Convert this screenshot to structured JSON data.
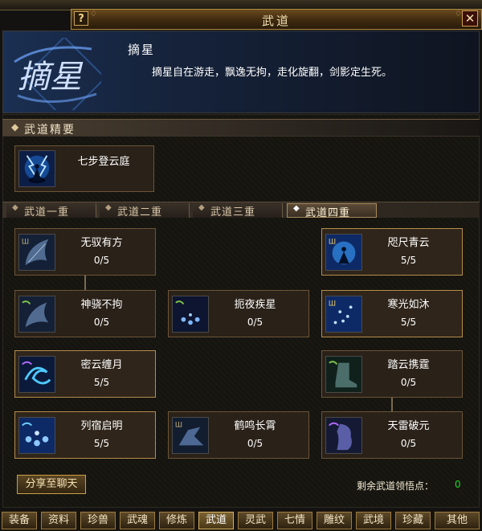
{
  "window": {
    "title": "武道",
    "help_label": "?",
    "close_label": "✕"
  },
  "skill": {
    "emblem_text": "摘星",
    "name": "摘星",
    "description": "摘星自在游走，飘逸无拘，走化旋翻，剑影定生死。"
  },
  "essence": {
    "title": "武道精要",
    "item": {
      "name": "七步登云庭",
      "icon": "meditation-lightning-icon"
    }
  },
  "tabs": [
    {
      "label": "武道一重",
      "active": false
    },
    {
      "label": "武道二重",
      "active": false
    },
    {
      "label": "武道三重",
      "active": false
    },
    {
      "label": "武道四重",
      "active": true
    }
  ],
  "skills": {
    "s1": {
      "name": "无驭有方",
      "progress": "0/5",
      "icon": "wing-icon",
      "highlighted": false
    },
    "s2": {
      "name": "咫尺青云",
      "progress": "5/5",
      "icon": "meditation-glow-icon",
      "highlighted": true
    },
    "s3": {
      "name": "神骁不拘",
      "progress": "0/5",
      "icon": "wing-icon",
      "highlighted": false
    },
    "s4": {
      "name": "扼夜疾星",
      "progress": "0/5",
      "icon": "star-orbs-icon",
      "highlighted": false
    },
    "s5": {
      "name": "寒光如沐",
      "progress": "5/5",
      "icon": "sparkle-rain-icon",
      "highlighted": true
    },
    "s6": {
      "name": "密云缠月",
      "progress": "5/5",
      "icon": "swirl-icon",
      "highlighted": true
    },
    "s7": {
      "name": "踏云携霆",
      "progress": "0/5",
      "icon": "boot-icon",
      "highlighted": false
    },
    "s8": {
      "name": "列宿启明",
      "progress": "5/5",
      "icon": "star-orbs-icon",
      "highlighted": true
    },
    "s9": {
      "name": "鹤鸣长霄",
      "progress": "0/5",
      "icon": "crane-icon",
      "highlighted": false
    },
    "s10": {
      "name": "天雷破元",
      "progress": "0/5",
      "icon": "cloak-icon",
      "highlighted": false
    }
  },
  "share_label": "分享至聊天",
  "remaining": {
    "label": "剩余武道领悟点：",
    "value": "0"
  },
  "bottom_tabs": [
    "装备",
    "资料",
    "珍兽",
    "武魂",
    "修炼",
    "武道",
    "灵武",
    "七情",
    "雕纹",
    "武境",
    "珍藏",
    "其他"
  ],
  "bottom_active": "武道",
  "colors": {
    "accent_gold": "#c9a049",
    "remain_value_green": "#2ad12a"
  }
}
